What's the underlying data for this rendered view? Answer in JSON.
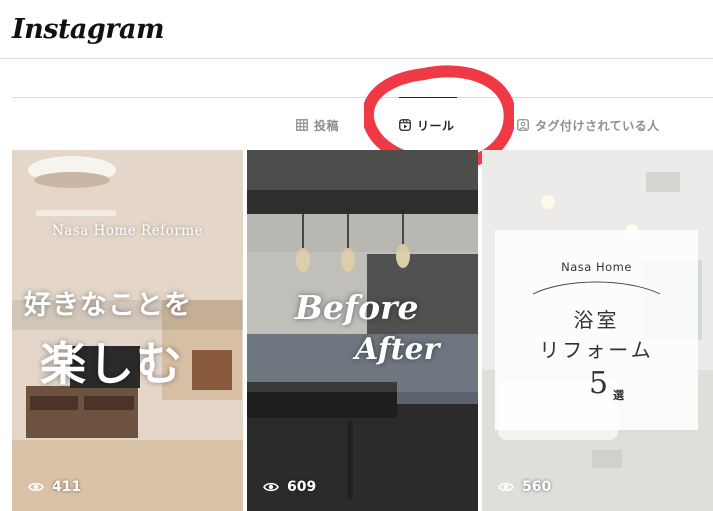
{
  "app": {
    "logo_text": "Instagram"
  },
  "tabs": [
    {
      "label": "投稿",
      "icon": "grid-icon",
      "active": false
    },
    {
      "label": "リール",
      "icon": "reels-icon",
      "active": true
    },
    {
      "label": "タグ付けされている人",
      "icon": "tagged-icon",
      "active": false
    }
  ],
  "annotation": {
    "color": "#ee2a36"
  },
  "reels": [
    {
      "brand": "Nasa Home Reforme",
      "caption_line1": "好きなことを",
      "caption_line2": "楽しむ",
      "views": "411"
    },
    {
      "caption_line1": "Before",
      "caption_line2": "After",
      "views": "609"
    },
    {
      "brand": "Nasa Home",
      "caption_line1": "浴室",
      "caption_line2": "リフォーム",
      "count": "5",
      "count_suffix": "選",
      "views": "560"
    }
  ],
  "colors": {
    "text": "#262626",
    "muted": "#8e8e8e",
    "divider": "#dbdbdb"
  }
}
